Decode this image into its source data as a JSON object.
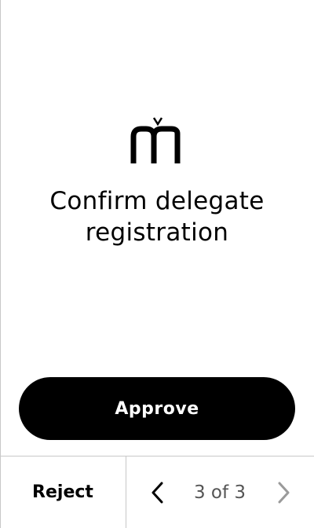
{
  "screen": {
    "logo_icon": "brand-logo-icon",
    "title_line1": "Confirm delegate",
    "title_line2": "registration"
  },
  "actions": {
    "approve_label": "Approve",
    "reject_label": "Reject"
  },
  "pager": {
    "current": 3,
    "total": 3,
    "label": "3 of 3",
    "prev_icon": "chevron-left-icon",
    "next_icon": "chevron-right-icon",
    "next_enabled": false
  },
  "colors": {
    "primary": "#000000",
    "background": "#ffffff",
    "divider": "#c8c8c8",
    "disabled_icon": "#9a9a9a",
    "muted_text": "#555555"
  }
}
